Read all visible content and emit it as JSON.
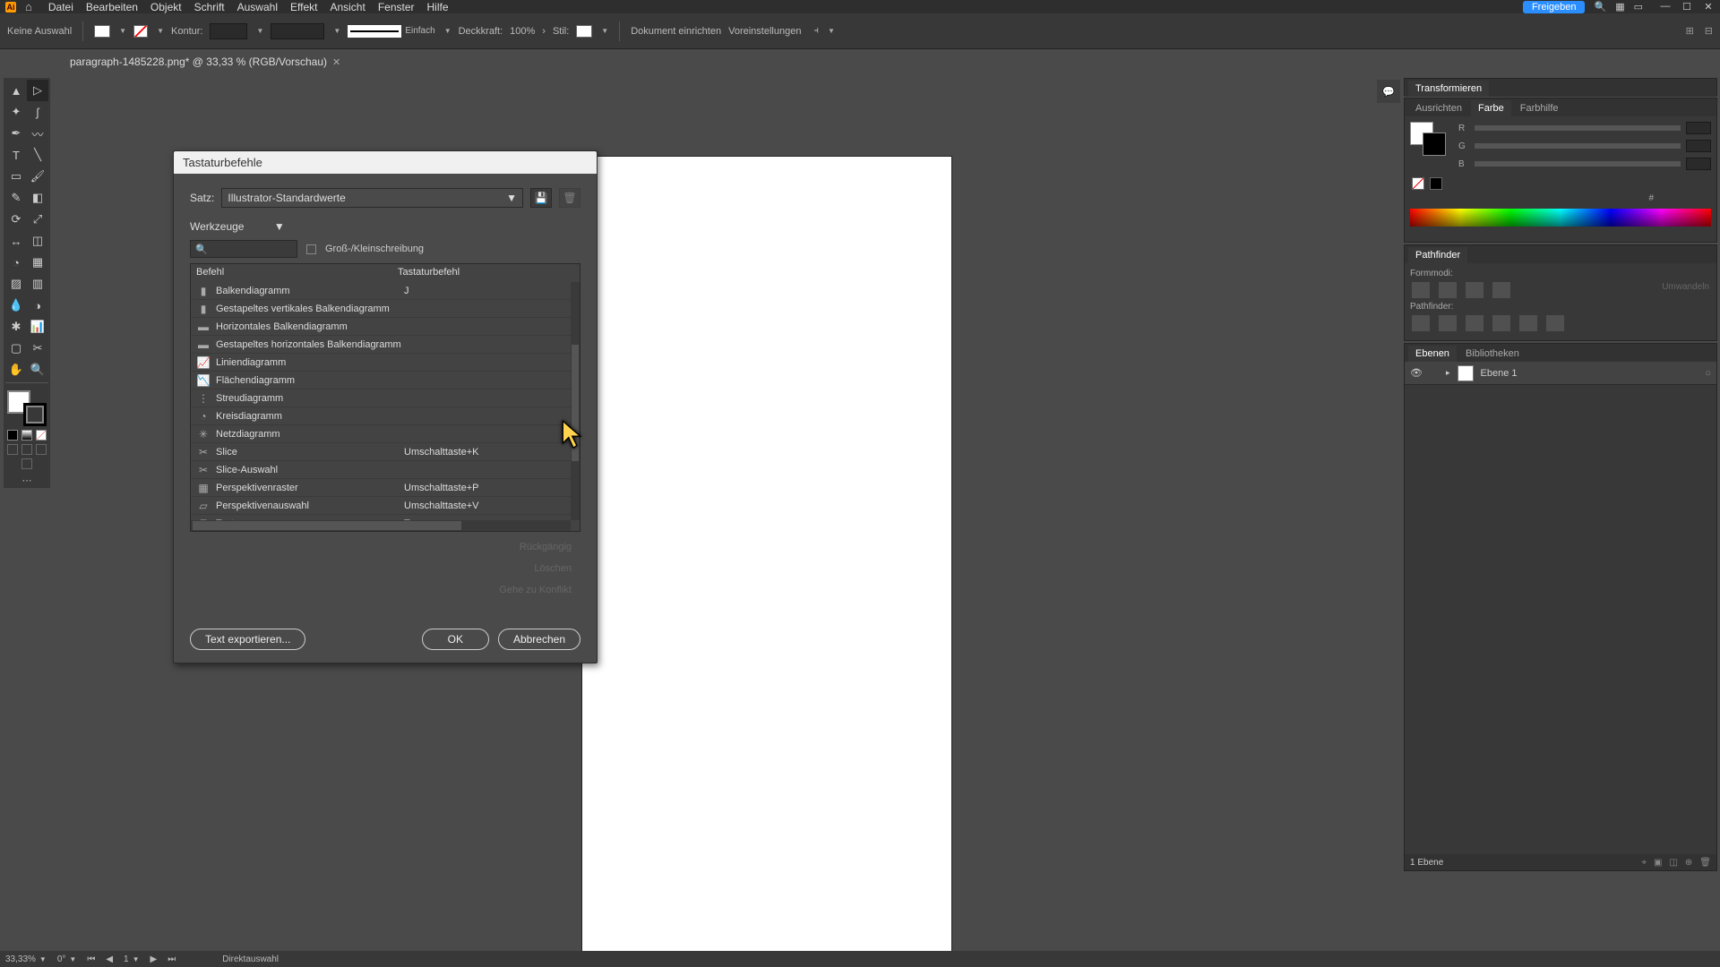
{
  "menubar": [
    "Datei",
    "Bearbeiten",
    "Objekt",
    "Schrift",
    "Auswahl",
    "Effekt",
    "Ansicht",
    "Fenster",
    "Hilfe"
  ],
  "share_label": "Freigeben",
  "controlbar": {
    "no_selection": "Keine Auswahl",
    "kontur": "Kontur:",
    "stroke_style": "Einfach",
    "deckkraft": "Deckkraft:",
    "opacity_value": "100%",
    "stil": "Stil:",
    "doc_setup": "Dokument einrichten",
    "prefs": "Voreinstellungen"
  },
  "tab_title": "paragraph-1485228.png* @ 33,33 % (RGB/Vorschau)",
  "dialog": {
    "title": "Tastaturbefehle",
    "set_label": "Satz:",
    "set_value": "Illustrator-Standardwerte",
    "type_value": "Werkzeuge",
    "case_label": "Groß-/Kleinschreibung",
    "col_cmd": "Befehl",
    "col_key": "Tastaturbefehl",
    "rows": [
      {
        "name": "Balkendiagramm",
        "key": "J"
      },
      {
        "name": "Gestapeltes vertikales Balkendiagramm",
        "key": ""
      },
      {
        "name": "Horizontales Balkendiagramm",
        "key": ""
      },
      {
        "name": "Gestapeltes horizontales Balkendiagramm",
        "key": ""
      },
      {
        "name": "Liniendiagramm",
        "key": ""
      },
      {
        "name": "Flächendiagramm",
        "key": ""
      },
      {
        "name": "Streudiagramm",
        "key": ""
      },
      {
        "name": "Kreisdiagramm",
        "key": ""
      },
      {
        "name": "Netzdiagramm",
        "key": ""
      },
      {
        "name": "Slice",
        "key": "Umschalttaste+K"
      },
      {
        "name": "Slice-Auswahl",
        "key": ""
      },
      {
        "name": "Perspektivenraster",
        "key": "Umschalttaste+P"
      },
      {
        "name": "Perspektivenauswahl",
        "key": "Umschalttaste+V"
      },
      {
        "name": "Text",
        "key": "T"
      }
    ],
    "undo": "Rückgängig",
    "clear": "Löschen",
    "goto": "Gehe zu Konflikt",
    "export": "Text exportieren...",
    "ok": "OK",
    "cancel": "Abbrechen"
  },
  "panels": {
    "transform": "Transformieren",
    "align": "Ausrichten",
    "color": "Farbe",
    "colorguide": "Farbhilfe",
    "pathfinder": "Pathfinder",
    "shapemode": "Formmodi:",
    "expand": "Umwandeln",
    "pflabel": "Pathfinder:",
    "layers": "Ebenen",
    "libraries": "Bibliotheken",
    "layer1": "Ebene 1",
    "layer_count": "1 Ebene",
    "rgb": {
      "r": "R",
      "g": "G",
      "b": "B"
    },
    "hex_prefix": "#"
  },
  "status": {
    "zoom": "33,33%",
    "rot": "0°",
    "page": "1",
    "tool": "Direktauswahl"
  }
}
